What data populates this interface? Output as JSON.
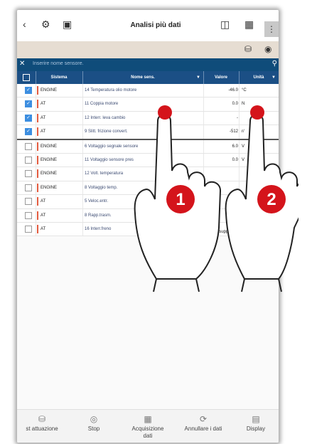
{
  "header": {
    "title": "Analisi più dati",
    "back_icon": "back-arrow-icon",
    "menu_icon": "more-vert-icon"
  },
  "search": {
    "placeholder": "Inserire nome sensore."
  },
  "table": {
    "columns": [
      "Sistema",
      "Nome sens.",
      "Valore",
      "Unità"
    ],
    "rows": [
      {
        "checked": true,
        "system": "ENGINE",
        "name": "14 Temperatura olio motore",
        "value": "-46.0",
        "unit": "°C"
      },
      {
        "checked": true,
        "system": "AT",
        "name": "11 Coppia motore",
        "value": "0.0",
        "unit": "N"
      },
      {
        "checked": true,
        "system": "AT",
        "name": "12 Interr. leva cambio",
        "value": "-",
        "unit": ""
      },
      {
        "checked": true,
        "system": "AT",
        "name": "9 Slitt. frizione convert.",
        "value": "-512",
        "unit": "r/"
      },
      {
        "checked": false,
        "system": "ENGINE",
        "name": "6 Voltaggio segnale sensore",
        "value": "6.0",
        "unit": "V"
      },
      {
        "checked": false,
        "system": "ENGINE",
        "name": "11 Voltaggio sensore pres",
        "value": "0.0",
        "unit": "V"
      },
      {
        "checked": false,
        "system": "ENGINE",
        "name": "12 Volt. temperatura",
        "value": "",
        "unit": ""
      },
      {
        "checked": false,
        "system": "ENGINE",
        "name": "8 Voltaggio temp.",
        "value": "",
        "unit": ""
      },
      {
        "checked": false,
        "system": "AT",
        "name": "5 Veloc.entr.",
        "value": "",
        "unit": ""
      },
      {
        "checked": false,
        "system": "AT",
        "name": "8 Rapp.trasm.",
        "value": "",
        "unit": ""
      },
      {
        "checked": false,
        "system": "AT",
        "name": "16 Interr.freno",
        "value": "No\nsupported",
        "unit": ""
      }
    ]
  },
  "toolbar": {
    "items": [
      {
        "label": "st attuazione",
        "icon": "car-test-icon"
      },
      {
        "label": "Stop",
        "icon": "stop-icon"
      },
      {
        "label": "Acquisizione\ndati",
        "icon": "capture-icon"
      },
      {
        "label": "Annullare i dati",
        "icon": "refresh-icon"
      },
      {
        "label": "Display",
        "icon": "display-icon"
      }
    ]
  },
  "overlay": {
    "finger1": "1",
    "finger2": "2"
  },
  "colors": {
    "header_blue": "#1b4f85",
    "search_blue": "#0f4c7a",
    "checkbox_blue": "#3d8ee0",
    "finger_red": "#d4141b"
  }
}
